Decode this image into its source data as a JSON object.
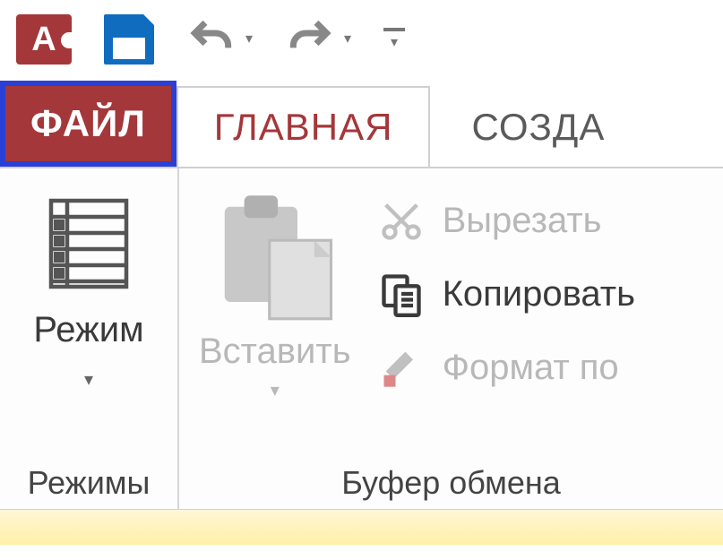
{
  "qat": {
    "app_letter": "A"
  },
  "tabs": {
    "file": "ФАЙЛ",
    "home": "ГЛАВНАЯ",
    "create": "СОЗДА"
  },
  "ribbon": {
    "views": {
      "mode_label": "Режим",
      "group_label": "Режимы"
    },
    "clipboard": {
      "paste_label": "Вставить",
      "cut_label": "Вырезать",
      "copy_label": "Копировать",
      "format_painter_label": "Формат по ",
      "group_label": "Буфер обмена"
    }
  }
}
